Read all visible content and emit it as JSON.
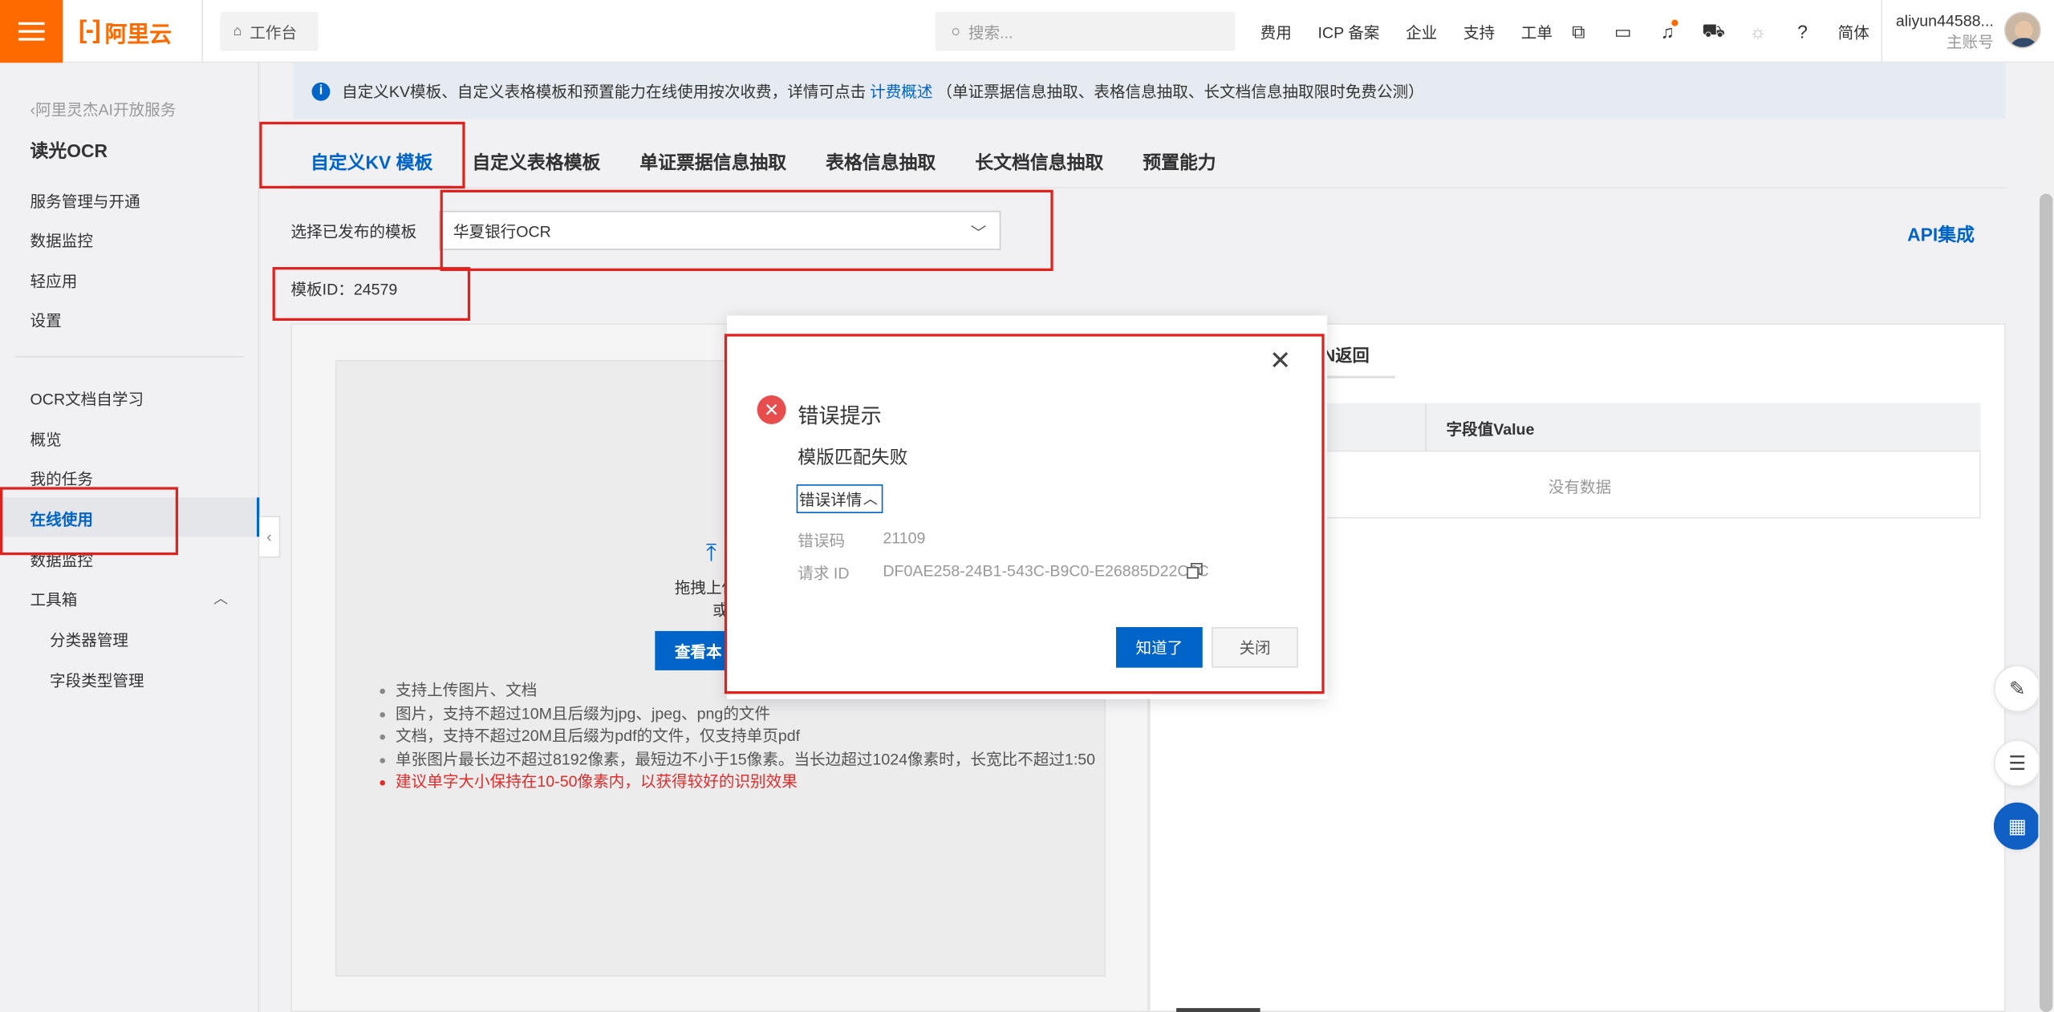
{
  "topbar": {
    "logo_text": "阿里云",
    "logo_mark": "[-]",
    "workbench": "工作台",
    "search_placeholder": "搜索...",
    "nav_links": [
      "费用",
      "ICP 备案",
      "企业",
      "支持",
      "工单"
    ],
    "lang": "简体",
    "account_name": "aliyun44588...",
    "account_role": "主账号",
    "accent": "#ff6a00"
  },
  "sidebar": {
    "back_link": "阿里灵杰AI开放服务",
    "title": "读光OCR",
    "items_top": [
      "服务管理与开通",
      "数据监控",
      "轻应用",
      "设置"
    ],
    "items_main": [
      "OCR文档自学习",
      "概览",
      "我的任务",
      "在线使用",
      "数据监控",
      "工具箱"
    ],
    "items_tool": [
      "分类器管理",
      "字段类型管理"
    ],
    "active_item": "在线使用"
  },
  "notice": {
    "text_before": "自定义KV模板、自定义表格模板和预置能力在线使用按次收费，详情可点击",
    "link": "计费概述",
    "text_after": "（单证票据信息抽取、表格信息抽取、长文档信息抽取限时免费公测）"
  },
  "tabs": [
    "自定义KV 模板",
    "自定义表格模板",
    "单证票据信息抽取",
    "表格信息抽取",
    "长文档信息抽取",
    "预置能力"
  ],
  "template": {
    "select_label": "选择已发布的模板",
    "selected": "华夏银行OCR",
    "id_label": "模板ID：",
    "id_value": "24579",
    "api_link": "API集成"
  },
  "upload": {
    "line1": "拖拽上传",
    "line2": "或",
    "button": "查看本",
    "tips": [
      "支持上传图片、文档",
      "图片，支持不超过10M且后缀为jpg、jpeg、png的文件",
      "文档，支持不超过20M且后缀为pdf的文件，仅支持单页pdf",
      "单张图片最长边不超过8192像素，最短边不小于15像素。当长边超过1024像素时，长宽比不超过1:50",
      "建议单字大小保持在10-50像素内，以获得较好的识别效果"
    ]
  },
  "result": {
    "tab": "N返回",
    "col_value": "字段值Value",
    "empty": "没有数据"
  },
  "dialog": {
    "title": "错误提示",
    "message": "模版匹配失败",
    "details_toggle": "错误详情",
    "code_label": "错误码",
    "code_value": "21109",
    "request_label": "请求 ID",
    "request_value": "DF0AE258-24B1-543C-B9C0-E26885D22C6C",
    "ok_button": "知道了",
    "close_button": "关闭",
    "error_color": "#e84d4d",
    "primary_color": "#0064c8"
  },
  "annotation_color": "#e0221f"
}
